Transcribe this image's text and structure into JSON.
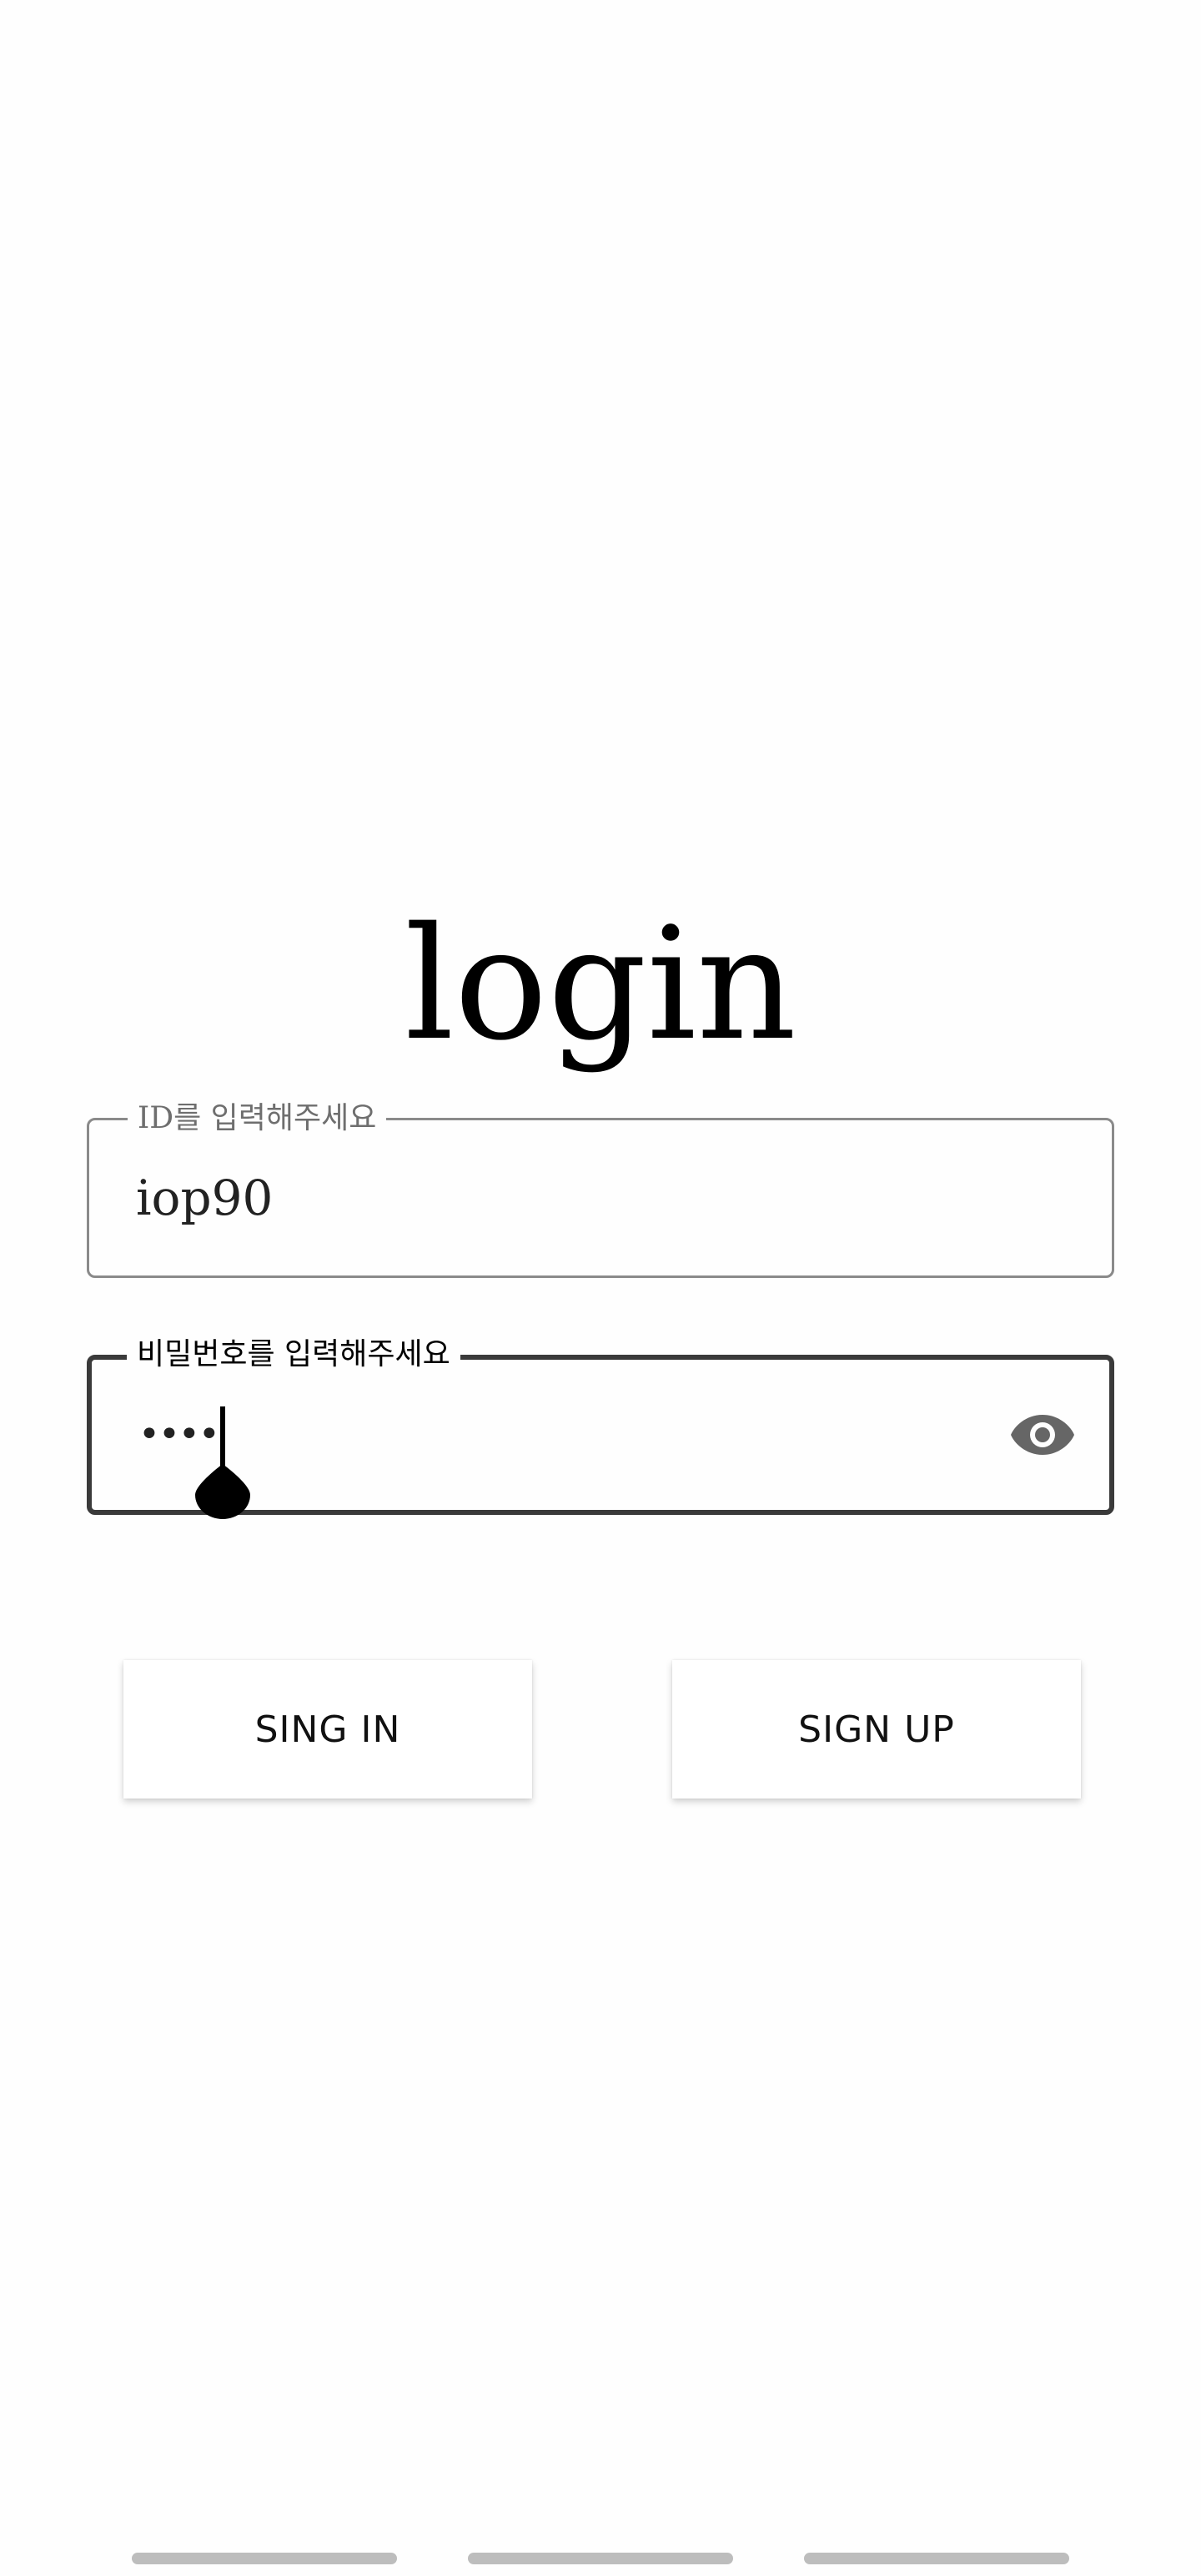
{
  "screen": {
    "title": "login"
  },
  "id_field": {
    "label": "ID를 입력해주세요",
    "value": "iop90"
  },
  "password_field": {
    "label": "비밀번호를 입력해주세요",
    "masked_value": "••••",
    "toggle_icon": "eye-icon"
  },
  "buttons": {
    "sign_in_label": "SING IN",
    "sign_up_label": "SIGN UP"
  },
  "page_indicator": {
    "count": 3
  },
  "colors": {
    "text": "#000000",
    "border_inactive": "#8a8a8a",
    "border_focused": "#3a3a3a",
    "indicator": "#bdbdbd",
    "background": "#fefefe"
  }
}
